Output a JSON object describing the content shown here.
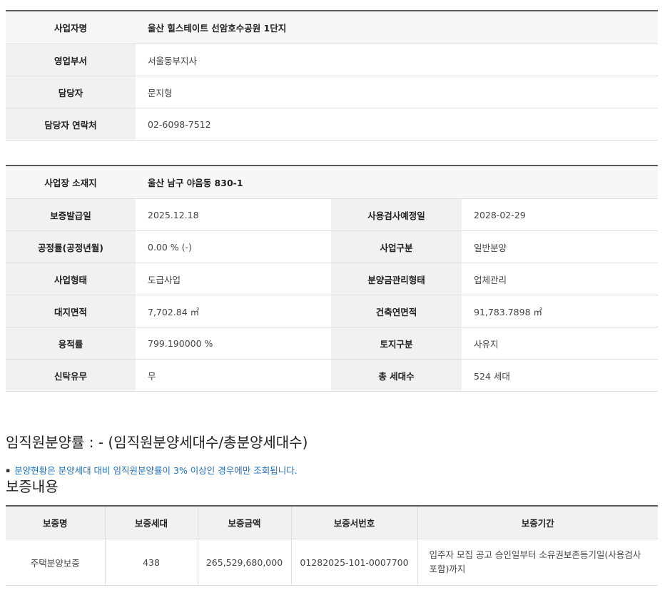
{
  "business": {
    "name_label": "사업자명",
    "name_value": "울산 힐스테이트 선암호수공원 1단지",
    "dept_label": "영업부서",
    "dept_value": "서울동부지사",
    "manager_label": "담당자",
    "manager_value": "문지형",
    "contact_label": "담당자 연락처",
    "contact_value": "02-6098-7512"
  },
  "site": {
    "location_label": "사업장 소재지",
    "location_value": "울산 남구 야음동  830-1",
    "rows": [
      {
        "l1": "보증발급일",
        "v1": "2025.12.18",
        "l2": "사용검사예정일",
        "v2": "2028-02-29"
      },
      {
        "l1": "공정률(공정년월)",
        "v1": "0.00 % (-)",
        "l2": "사업구분",
        "v2": "일반분양"
      },
      {
        "l1": "사업형태",
        "v1": "도급사업",
        "l2": "분양금관리형태",
        "v2": "업체관리"
      },
      {
        "l1": "대지면적",
        "v1": "7,702.84 ㎡",
        "l2": "건축연면적",
        "v2": "91,783.7898 ㎡"
      },
      {
        "l1": "용적률",
        "v1": "799.190000 %",
        "l2": "토지구분",
        "v2": "사유지"
      },
      {
        "l1": "신탁유무",
        "v1": "무",
        "l2": "총 세대수",
        "v2": "524 세대"
      }
    ]
  },
  "ratio": {
    "title": "임직원분양률 : - (임직원분양세대수/총분양세대수)",
    "notice": "분양현황은 분양세대 대비 임직원분양률이 3% 이상인 경우에만 조회됩니다."
  },
  "guarantee": {
    "title": "보증내용",
    "headers": [
      "보증명",
      "보증세대",
      "보증금액",
      "보증서번호",
      "보증기간"
    ],
    "rows": [
      {
        "name": "주택분양보증",
        "units": "438",
        "amount": "265,529,680,000",
        "number": "01282025-101-0007700",
        "period": "입주자 모집 공고 승인일부터 소유권보존등기일(사용검사포함)까지"
      }
    ]
  }
}
